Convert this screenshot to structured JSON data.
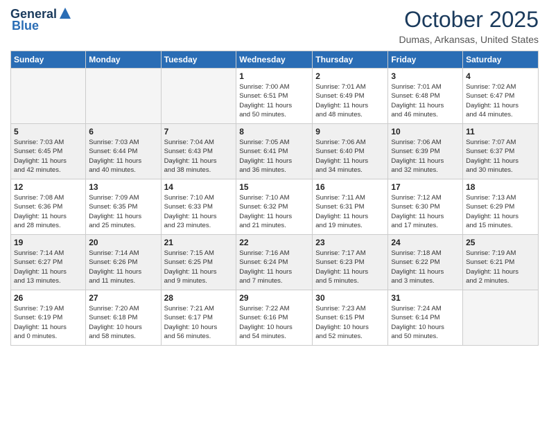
{
  "logo": {
    "general": "General",
    "blue": "Blue"
  },
  "header": {
    "month": "October 2025",
    "location": "Dumas, Arkansas, United States"
  },
  "weekdays": [
    "Sunday",
    "Monday",
    "Tuesday",
    "Wednesday",
    "Thursday",
    "Friday",
    "Saturday"
  ],
  "weeks": [
    [
      {
        "day": "",
        "info": ""
      },
      {
        "day": "",
        "info": ""
      },
      {
        "day": "",
        "info": ""
      },
      {
        "day": "1",
        "info": "Sunrise: 7:00 AM\nSunset: 6:51 PM\nDaylight: 11 hours\nand 50 minutes."
      },
      {
        "day": "2",
        "info": "Sunrise: 7:01 AM\nSunset: 6:49 PM\nDaylight: 11 hours\nand 48 minutes."
      },
      {
        "day": "3",
        "info": "Sunrise: 7:01 AM\nSunset: 6:48 PM\nDaylight: 11 hours\nand 46 minutes."
      },
      {
        "day": "4",
        "info": "Sunrise: 7:02 AM\nSunset: 6:47 PM\nDaylight: 11 hours\nand 44 minutes."
      }
    ],
    [
      {
        "day": "5",
        "info": "Sunrise: 7:03 AM\nSunset: 6:45 PM\nDaylight: 11 hours\nand 42 minutes."
      },
      {
        "day": "6",
        "info": "Sunrise: 7:03 AM\nSunset: 6:44 PM\nDaylight: 11 hours\nand 40 minutes."
      },
      {
        "day": "7",
        "info": "Sunrise: 7:04 AM\nSunset: 6:43 PM\nDaylight: 11 hours\nand 38 minutes."
      },
      {
        "day": "8",
        "info": "Sunrise: 7:05 AM\nSunset: 6:41 PM\nDaylight: 11 hours\nand 36 minutes."
      },
      {
        "day": "9",
        "info": "Sunrise: 7:06 AM\nSunset: 6:40 PM\nDaylight: 11 hours\nand 34 minutes."
      },
      {
        "day": "10",
        "info": "Sunrise: 7:06 AM\nSunset: 6:39 PM\nDaylight: 11 hours\nand 32 minutes."
      },
      {
        "day": "11",
        "info": "Sunrise: 7:07 AM\nSunset: 6:37 PM\nDaylight: 11 hours\nand 30 minutes."
      }
    ],
    [
      {
        "day": "12",
        "info": "Sunrise: 7:08 AM\nSunset: 6:36 PM\nDaylight: 11 hours\nand 28 minutes."
      },
      {
        "day": "13",
        "info": "Sunrise: 7:09 AM\nSunset: 6:35 PM\nDaylight: 11 hours\nand 25 minutes."
      },
      {
        "day": "14",
        "info": "Sunrise: 7:10 AM\nSunset: 6:33 PM\nDaylight: 11 hours\nand 23 minutes."
      },
      {
        "day": "15",
        "info": "Sunrise: 7:10 AM\nSunset: 6:32 PM\nDaylight: 11 hours\nand 21 minutes."
      },
      {
        "day": "16",
        "info": "Sunrise: 7:11 AM\nSunset: 6:31 PM\nDaylight: 11 hours\nand 19 minutes."
      },
      {
        "day": "17",
        "info": "Sunrise: 7:12 AM\nSunset: 6:30 PM\nDaylight: 11 hours\nand 17 minutes."
      },
      {
        "day": "18",
        "info": "Sunrise: 7:13 AM\nSunset: 6:29 PM\nDaylight: 11 hours\nand 15 minutes."
      }
    ],
    [
      {
        "day": "19",
        "info": "Sunrise: 7:14 AM\nSunset: 6:27 PM\nDaylight: 11 hours\nand 13 minutes."
      },
      {
        "day": "20",
        "info": "Sunrise: 7:14 AM\nSunset: 6:26 PM\nDaylight: 11 hours\nand 11 minutes."
      },
      {
        "day": "21",
        "info": "Sunrise: 7:15 AM\nSunset: 6:25 PM\nDaylight: 11 hours\nand 9 minutes."
      },
      {
        "day": "22",
        "info": "Sunrise: 7:16 AM\nSunset: 6:24 PM\nDaylight: 11 hours\nand 7 minutes."
      },
      {
        "day": "23",
        "info": "Sunrise: 7:17 AM\nSunset: 6:23 PM\nDaylight: 11 hours\nand 5 minutes."
      },
      {
        "day": "24",
        "info": "Sunrise: 7:18 AM\nSunset: 6:22 PM\nDaylight: 11 hours\nand 3 minutes."
      },
      {
        "day": "25",
        "info": "Sunrise: 7:19 AM\nSunset: 6:21 PM\nDaylight: 11 hours\nand 2 minutes."
      }
    ],
    [
      {
        "day": "26",
        "info": "Sunrise: 7:19 AM\nSunset: 6:19 PM\nDaylight: 11 hours\nand 0 minutes."
      },
      {
        "day": "27",
        "info": "Sunrise: 7:20 AM\nSunset: 6:18 PM\nDaylight: 10 hours\nand 58 minutes."
      },
      {
        "day": "28",
        "info": "Sunrise: 7:21 AM\nSunset: 6:17 PM\nDaylight: 10 hours\nand 56 minutes."
      },
      {
        "day": "29",
        "info": "Sunrise: 7:22 AM\nSunset: 6:16 PM\nDaylight: 10 hours\nand 54 minutes."
      },
      {
        "day": "30",
        "info": "Sunrise: 7:23 AM\nSunset: 6:15 PM\nDaylight: 10 hours\nand 52 minutes."
      },
      {
        "day": "31",
        "info": "Sunrise: 7:24 AM\nSunset: 6:14 PM\nDaylight: 10 hours\nand 50 minutes."
      },
      {
        "day": "",
        "info": ""
      }
    ]
  ]
}
